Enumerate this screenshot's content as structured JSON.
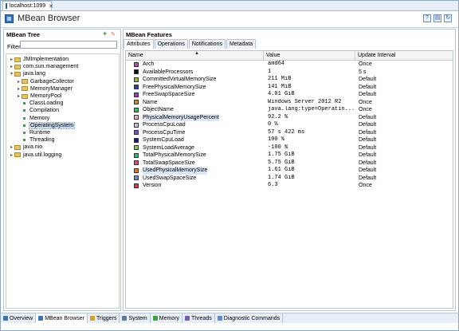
{
  "doc_tab": {
    "label": "localhost:1099"
  },
  "header": {
    "title": "MBean Browser"
  },
  "left": {
    "title": "MBean Tree",
    "filter_label": "Filter:",
    "filter_value": "",
    "tree": [
      {
        "label": "JMImplementation",
        "type": "folder",
        "expanded": false,
        "level": 0
      },
      {
        "label": "com.sun.management",
        "type": "folder",
        "expanded": false,
        "level": 0
      },
      {
        "label": "java.lang",
        "type": "folder",
        "expanded": true,
        "level": 0
      },
      {
        "label": "GarbageCollector",
        "type": "folder",
        "expanded": false,
        "level": 1
      },
      {
        "label": "MemoryManager",
        "type": "folder",
        "expanded": false,
        "level": 1
      },
      {
        "label": "MemoryPool",
        "type": "folder",
        "expanded": false,
        "level": 1
      },
      {
        "label": "ClassLoading",
        "type": "leaf",
        "level": 1,
        "color": "#3aa33a"
      },
      {
        "label": "Compilation",
        "type": "leaf",
        "level": 1,
        "color": "#3aa33a"
      },
      {
        "label": "Memory",
        "type": "leaf",
        "level": 1,
        "color": "#3aa33a"
      },
      {
        "label": "OperatingSystem",
        "type": "leaf",
        "level": 1,
        "color": "#3aa33a",
        "selected": true
      },
      {
        "label": "Runtime",
        "type": "leaf",
        "level": 1,
        "color": "#3aa33a"
      },
      {
        "label": "Threading",
        "type": "leaf",
        "level": 1,
        "color": "#3aa33a"
      },
      {
        "label": "java.nio",
        "type": "folder",
        "expanded": false,
        "level": 0
      },
      {
        "label": "java.util.logging",
        "type": "folder",
        "expanded": false,
        "level": 0
      }
    ]
  },
  "right": {
    "title": "MBean Features",
    "tabs": [
      "Attributes",
      "Operations",
      "Notifications",
      "Metadata"
    ],
    "columns": [
      "Name",
      "Value",
      "Update Interval"
    ],
    "rows": [
      {
        "name": "Arch",
        "value": "amd64",
        "interval": "Once",
        "color": "#b04ab0"
      },
      {
        "name": "AvailableProcessors",
        "value": "1",
        "interval": "5 s",
        "color": "#111111"
      },
      {
        "name": "CommittedVirtualMemorySize",
        "value": "211 MiB",
        "interval": "Default",
        "color": "#8fbf3a"
      },
      {
        "name": "FreePhysicalMemorySize",
        "value": "141 MiB",
        "interval": "Default",
        "color": "#2a3aa8"
      },
      {
        "name": "FreeSwapSpaceSize",
        "value": "4.01 GiB",
        "interval": "Default",
        "color": "#9a3ac7"
      },
      {
        "name": "Name",
        "value": "Windows Server 2012 R2",
        "interval": "Once",
        "color": "#c8912a"
      },
      {
        "name": "ObjectName",
        "value": "java.lang:type=Operatin...",
        "interval": "Once",
        "color": "#2fc06a"
      },
      {
        "name": "PhysicalMemoryUsagePercent",
        "value": "92.2 %",
        "interval": "Default",
        "color": "#f0a9c9"
      },
      {
        "name": "ProcessCpuLoad",
        "value": "0 %",
        "interval": "Default",
        "color": "#c4c4e8"
      },
      {
        "name": "ProcessCpuTime",
        "value": "57 s 422 ms",
        "interval": "Default",
        "color": "#7a4ec4"
      },
      {
        "name": "SystemCpuLoad",
        "value": "100 %",
        "interval": "Default",
        "color": "#1a1a7a"
      },
      {
        "name": "SystemLoadAverage",
        "value": "-100 %",
        "interval": "Default",
        "color": "#7ad05a"
      },
      {
        "name": "TotalPhysicalMemorySize",
        "value": "1.75 GiB",
        "interval": "Default",
        "color": "#3ab86a"
      },
      {
        "name": "TotalSwapSpaceSize",
        "value": "5.75 GiB",
        "interval": "Default",
        "color": "#e04a7a"
      },
      {
        "name": "UsedPhysicalMemorySize",
        "value": "1.61 GiB",
        "interval": "Default",
        "color": "#e07a1a"
      },
      {
        "name": "UsedSwapSpaceSize",
        "value": "1.74 GiB",
        "interval": "Default",
        "color": "#7a8ad8"
      },
      {
        "name": "Version",
        "value": "6.3",
        "interval": "Once",
        "color": "#d03a4a"
      }
    ]
  },
  "bottom_tabs": [
    {
      "label": "Overview",
      "icon": "overview-icon",
      "color": "#3a73b8"
    },
    {
      "label": "MBean Browser",
      "icon": "mbean-browser-icon",
      "color": "#3a73b8",
      "active": true
    },
    {
      "label": "Triggers",
      "icon": "triggers-icon",
      "color": "#d8a02a"
    },
    {
      "label": "System",
      "icon": "system-icon",
      "color": "#5a7a9a"
    },
    {
      "label": "Memory",
      "icon": "memory-icon",
      "color": "#3aa33a"
    },
    {
      "label": "Threads",
      "icon": "threads-icon",
      "color": "#7a5ac0"
    },
    {
      "label": "Diagnostic Commands",
      "icon": "diagnostic-commands-icon",
      "color": "#5a8ad8"
    }
  ]
}
